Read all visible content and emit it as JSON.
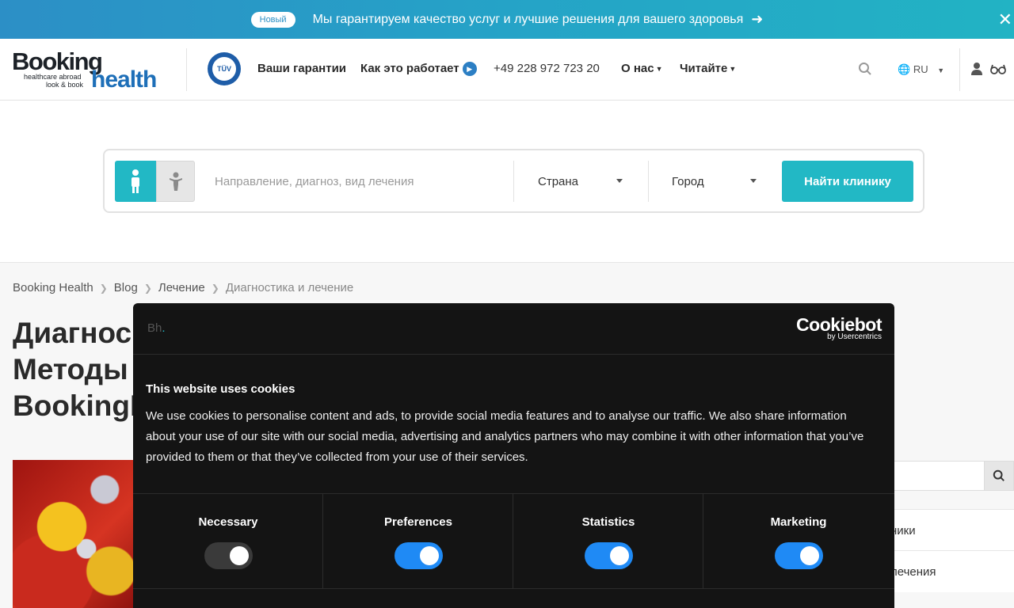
{
  "banner": {
    "badge": "Новый",
    "text": "Мы гарантируем качество услуг и лучшие решения для вашего здоровья",
    "arrow_icon": "arrow-right-icon",
    "close_icon": "close-icon"
  },
  "logo": {
    "booking": "Booking",
    "health": "health",
    "tagline1": "healthcare abroad",
    "tagline2": "look & book"
  },
  "tuv": {
    "text": "TÜV"
  },
  "nav": {
    "guarantees": "Ваши гарантии",
    "how_it_works": "Как это работает",
    "phone": "+49 228 972 723 20",
    "about": "О нас",
    "read": "Читайте"
  },
  "lang": {
    "code": "RU"
  },
  "search": {
    "placeholder": "Направление, диагноз, вид лечения",
    "country": "Страна",
    "city": "Город",
    "find_button": "Найти клинику"
  },
  "breadcrumb": {
    "items": [
      "Booking Health",
      "Blog",
      "Лечение"
    ],
    "current": "Диагностика и лечение"
  },
  "title": {
    "line1": "Диагнос",
    "line2": "Методы",
    "line3": "BookingH"
  },
  "sidebar": {
    "items": [
      "ники",
      "лечения"
    ]
  },
  "cookie_dialog": {
    "logo": "Bh",
    "logo_dot": ".",
    "brand": "Cookiebot",
    "brand_sub": "by Usercentrics",
    "heading": "This website uses cookies",
    "body": "We use cookies to personalise content and ads, to provide social media features and to analyse our traffic. We also share information about your use of our site with our social media, advertising and analytics partners who may combine it with other information that you’ve provided to them or that they’ve collected from your use of their services.",
    "categories": [
      {
        "label": "Necessary",
        "enabled": false
      },
      {
        "label": "Preferences",
        "enabled": true
      },
      {
        "label": "Statistics",
        "enabled": true
      },
      {
        "label": "Marketing",
        "enabled": true
      }
    ]
  },
  "colors": {
    "accent": "#22b8c5",
    "brand_blue": "#1e6fb8",
    "toggle_on": "#1f8af5"
  }
}
